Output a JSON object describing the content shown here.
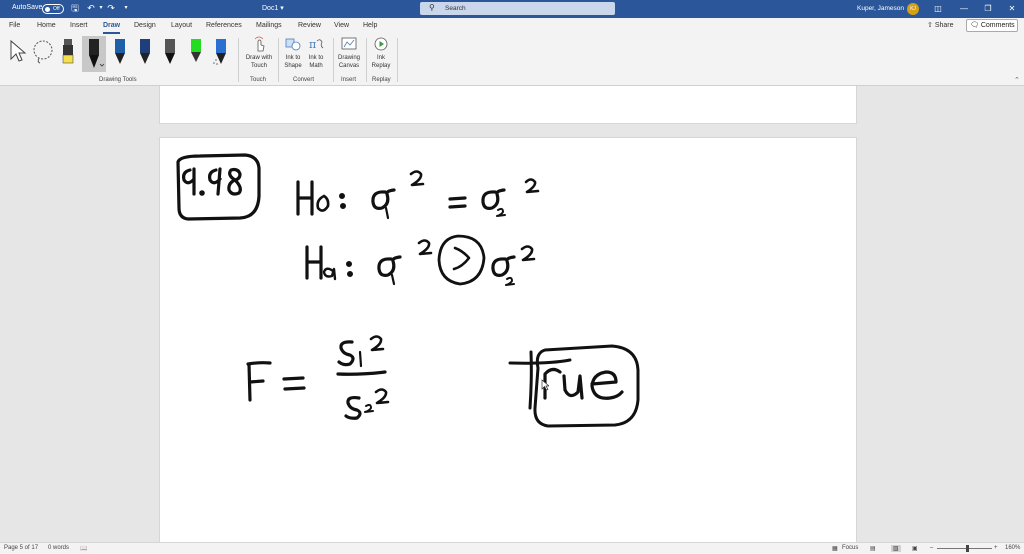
{
  "titlebar": {
    "autosave_label": "AutoSave",
    "autosave_state": "Off",
    "doc_title": "Doc1",
    "search_placeholder": "Search",
    "user_name": "Kuper, Jameson",
    "user_initials": "KJ"
  },
  "tabs": [
    {
      "label": "File"
    },
    {
      "label": "Home"
    },
    {
      "label": "Insert"
    },
    {
      "label": "Draw"
    },
    {
      "label": "Design"
    },
    {
      "label": "Layout"
    },
    {
      "label": "References"
    },
    {
      "label": "Mailings"
    },
    {
      "label": "Review"
    },
    {
      "label": "View"
    },
    {
      "label": "Help"
    }
  ],
  "share_label": "Share",
  "comments_label": "Comments",
  "ribbon": {
    "drawing_tools_label": "Drawing Tools",
    "touch_label": "Touch",
    "convert_label": "Convert",
    "insert_label": "Insert",
    "replay_label": "Replay",
    "draw_with_touch_l1": "Draw with",
    "draw_with_touch_l2": "Touch",
    "ink_to_shape_l1": "Ink to",
    "ink_to_shape_l2": "Shape",
    "ink_to_math_l1": "Ink to",
    "ink_to_math_l2": "Math",
    "drawing_canvas_l1": "Drawing",
    "drawing_canvas_l2": "Canvas",
    "ink_replay_l1": "Ink",
    "ink_replay_l2": "Replay",
    "pen_colors": {
      "highlighter": "#f4e04d",
      "black_pen": "#111111",
      "pen2": "#1f5fa8",
      "pen3": "#1e3f7a",
      "pen4": "#111111",
      "green_highlighter": "#22dd22",
      "pen5": "#2b6fd1"
    }
  },
  "status": {
    "page": "Page 5 of 17",
    "words": "0 words",
    "focus": "Focus",
    "zoom": "160%"
  },
  "colors": {
    "accent": "#2b579a",
    "ink": "#111111"
  }
}
